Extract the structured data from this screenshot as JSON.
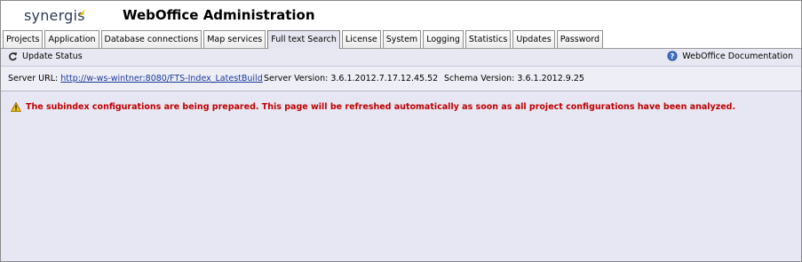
{
  "header": {
    "logo_text": "synergis",
    "app_title": "WebOffice Administration"
  },
  "tabs": [
    {
      "label": "Projects",
      "active": false
    },
    {
      "label": "Application",
      "active": false
    },
    {
      "label": "Database connections",
      "active": false
    },
    {
      "label": "Map services",
      "active": false
    },
    {
      "label": "Full text Search",
      "active": true
    },
    {
      "label": "License",
      "active": false
    },
    {
      "label": "System",
      "active": false
    },
    {
      "label": "Logging",
      "active": false
    },
    {
      "label": "Statistics",
      "active": false
    },
    {
      "label": "Updates",
      "active": false
    },
    {
      "label": "Password",
      "active": false
    }
  ],
  "toolbar": {
    "update_status_label": "Update Status",
    "documentation_label": "WebOffice Documentation"
  },
  "info": {
    "server_url_label": "Server URL:",
    "server_url_value": "http://w-ws-wintner:8080/FTS-Index_LatestBuild",
    "server_version_label": "Server Version:",
    "server_version_value": "3.6.1.2012.7.17.12.45.52",
    "schema_version_label": "Schema Version:",
    "schema_version_value": "3.6.1.2012.9.25"
  },
  "message": {
    "warning_text": "The subindex configurations are being prepared. This page will be refreshed automatically as soon as all project configurations have been analyzed."
  },
  "icons": {
    "logo": "logo-mark-icon",
    "refresh": "refresh-icon",
    "help": "help-icon",
    "warning": "warning-icon"
  },
  "colors": {
    "accent_yellow": "#f2c200",
    "warning_text": "#c00000",
    "link": "#1a3a9a",
    "content_bg": "#e7e7f3"
  }
}
